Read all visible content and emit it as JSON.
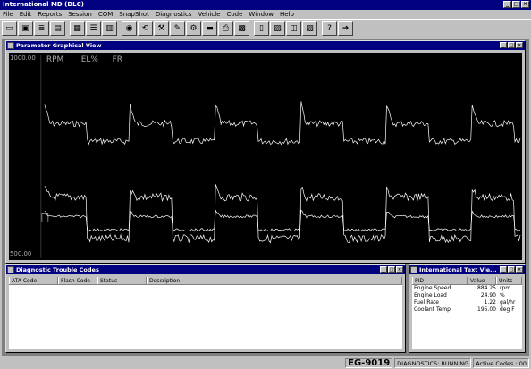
{
  "app": {
    "title": "International MD (DLC)"
  },
  "menu": [
    "File",
    "Edit",
    "Reports",
    "Session",
    "COM",
    "SnapShot",
    "Diagnostics",
    "Vehicle",
    "Code",
    "Window",
    "Help"
  ],
  "toolbar_icons": [
    "folder-icon",
    "window-icon",
    "report-icon",
    "session-icon",
    "grid-icon",
    "list-icon",
    "chart-icon",
    "gauge-icon",
    "reset-icon",
    "wrench-icon",
    "tool-icon",
    "engine-icon",
    "module-icon",
    "print-icon",
    "data-icon",
    "print2-icon",
    "param-icon",
    "freeze-icon",
    "snapshot-icon",
    "graph-icon",
    "help-icon",
    "exit-icon"
  ],
  "graph_window": {
    "title": "Parameter Graphical View",
    "legend": [
      "RPM",
      "EL%",
      "FR"
    ],
    "y_top": "1000.00",
    "y_bottom": "500.00"
  },
  "dtc_window": {
    "title": "Diagnostic Trouble Codes",
    "columns": [
      "ATA Code",
      "Flash Code",
      "Status",
      "Description"
    ]
  },
  "text_window": {
    "title": "International Text Vie...",
    "columns": [
      "PID",
      "Value",
      "Units"
    ],
    "rows": [
      {
        "pid": "Engine Speed",
        "value": "884.25",
        "units": "rpm"
      },
      {
        "pid": "Engine Load",
        "value": "24.90",
        "units": "%"
      },
      {
        "pid": "Fuel Rate",
        "value": "1.22",
        "units": "gal/hr"
      },
      {
        "pid": "Coolant Temp",
        "value": "195.00",
        "units": "deg F"
      }
    ]
  },
  "status": {
    "id": "EG-9019",
    "mode": "DIAGNOSTICS: RUNNING",
    "active_codes": "Active Codes : 00"
  },
  "colors": {
    "titlebar": "#000080",
    "face": "#c0c0c0",
    "graph_bg": "#000000",
    "trace": "#ffffff"
  }
}
